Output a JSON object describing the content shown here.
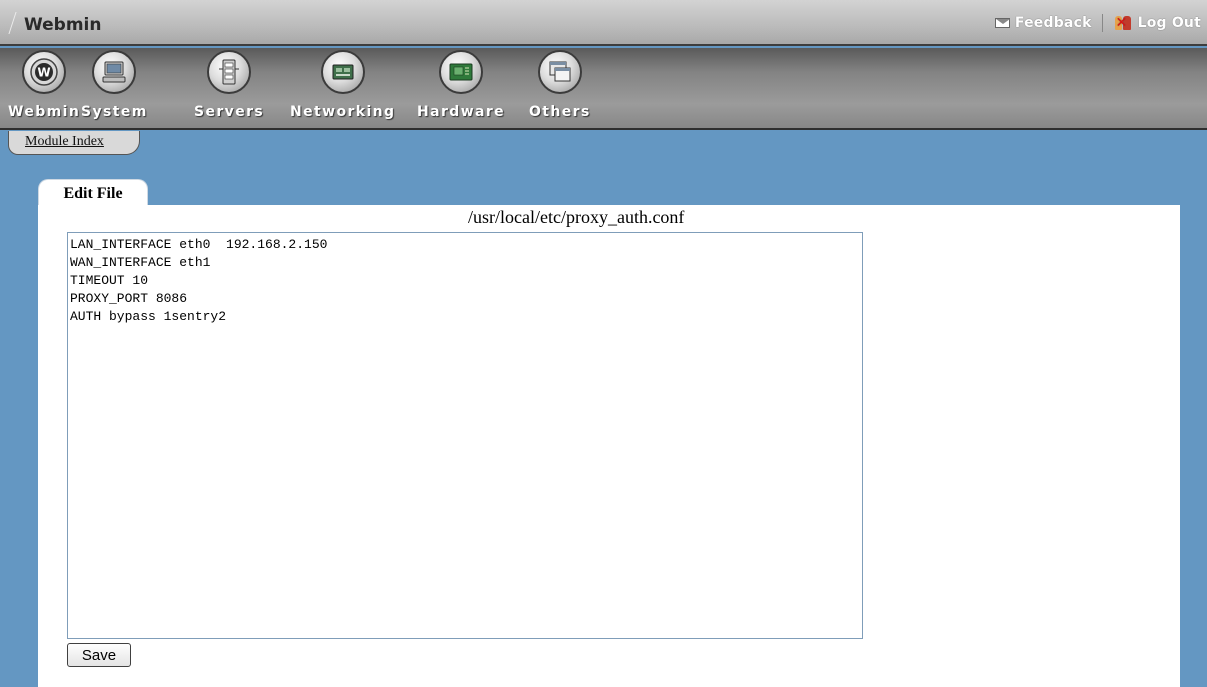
{
  "header": {
    "app_title": "Webmin",
    "feedback_label": "Feedback",
    "logout_label": "Log Out"
  },
  "nav": {
    "items": [
      {
        "label": "Webmin",
        "icon": "webmin-logo-icon"
      },
      {
        "label": "System",
        "icon": "computer-icon"
      },
      {
        "label": "Servers",
        "icon": "server-rack-icon"
      },
      {
        "label": "Networking",
        "icon": "network-card-icon"
      },
      {
        "label": "Hardware",
        "icon": "circuit-board-icon"
      },
      {
        "label": "Others",
        "icon": "windows-icon"
      }
    ]
  },
  "module_index_label": "Module Index",
  "page": {
    "tab_title": "Edit File",
    "file_path": "/usr/local/etc/proxy_auth.conf",
    "file_content": "LAN_INTERFACE eth0  192.168.2.150\nWAN_INTERFACE eth1\nTIMEOUT 10\nPROXY_PORT 8086\nAUTH bypass 1sentry2",
    "save_label": "Save"
  },
  "colors": {
    "page_background": "#6497c2",
    "panel_background": "#ffffff",
    "textarea_border": "#7f9db9"
  }
}
